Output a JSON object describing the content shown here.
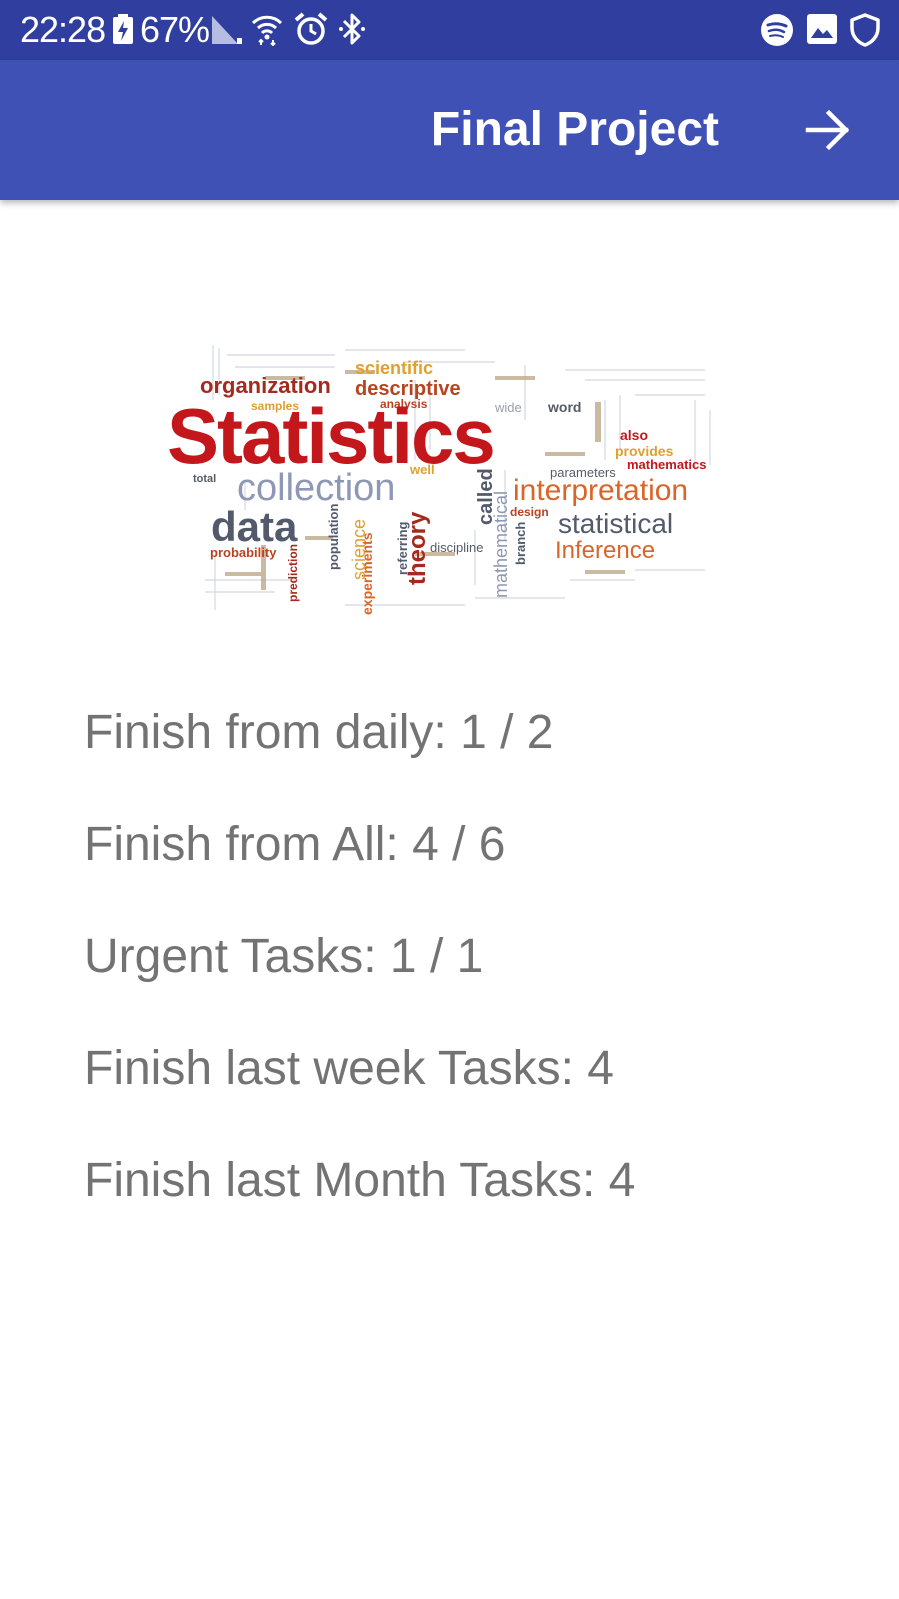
{
  "status_bar": {
    "time": "22:28",
    "battery": "67%",
    "icons": [
      "battery-charging-icon",
      "signal-icon",
      "wifi-icon",
      "alarm-icon",
      "bluetooth-icon",
      "spotify-icon",
      "gallery-icon",
      "shield-icon"
    ]
  },
  "app_bar": {
    "title": "Final Project",
    "action_icon": "arrow-forward-icon",
    "color": "#3f51b5",
    "status_color": "#303f9f"
  },
  "hero_image": {
    "words": {
      "statistics": "Statistics",
      "organization": "organization",
      "scientific": "scientific",
      "descriptive": "descriptive",
      "analysis": "analysis",
      "samples": "samples",
      "collection": "collection",
      "data": "data",
      "interpretation": "interpretation",
      "statistical": "statistical",
      "inference": "Inference",
      "probability": "probability",
      "theory": "theory",
      "mathematical": "mathematical",
      "called": "called",
      "parameters": "parameters",
      "mathematics": "mathematics",
      "provides": "provides",
      "also": "also",
      "total": "total",
      "population": "population",
      "prediction": "prediction",
      "science": "science",
      "experiments": "experiments",
      "referring": "referring",
      "discipline": "discipline",
      "branch": "branch",
      "design": "design",
      "word": "word",
      "wide": "wide",
      "well": "well"
    }
  },
  "stats": {
    "daily": "Finish from daily: 1 / 2",
    "all": "Finish from All: 4 / 6",
    "urgent": "Urgent Tasks: 1 / 1",
    "last_week": "Finish last week Tasks: 4",
    "last_month": "Finish last Month Tasks: 4"
  }
}
